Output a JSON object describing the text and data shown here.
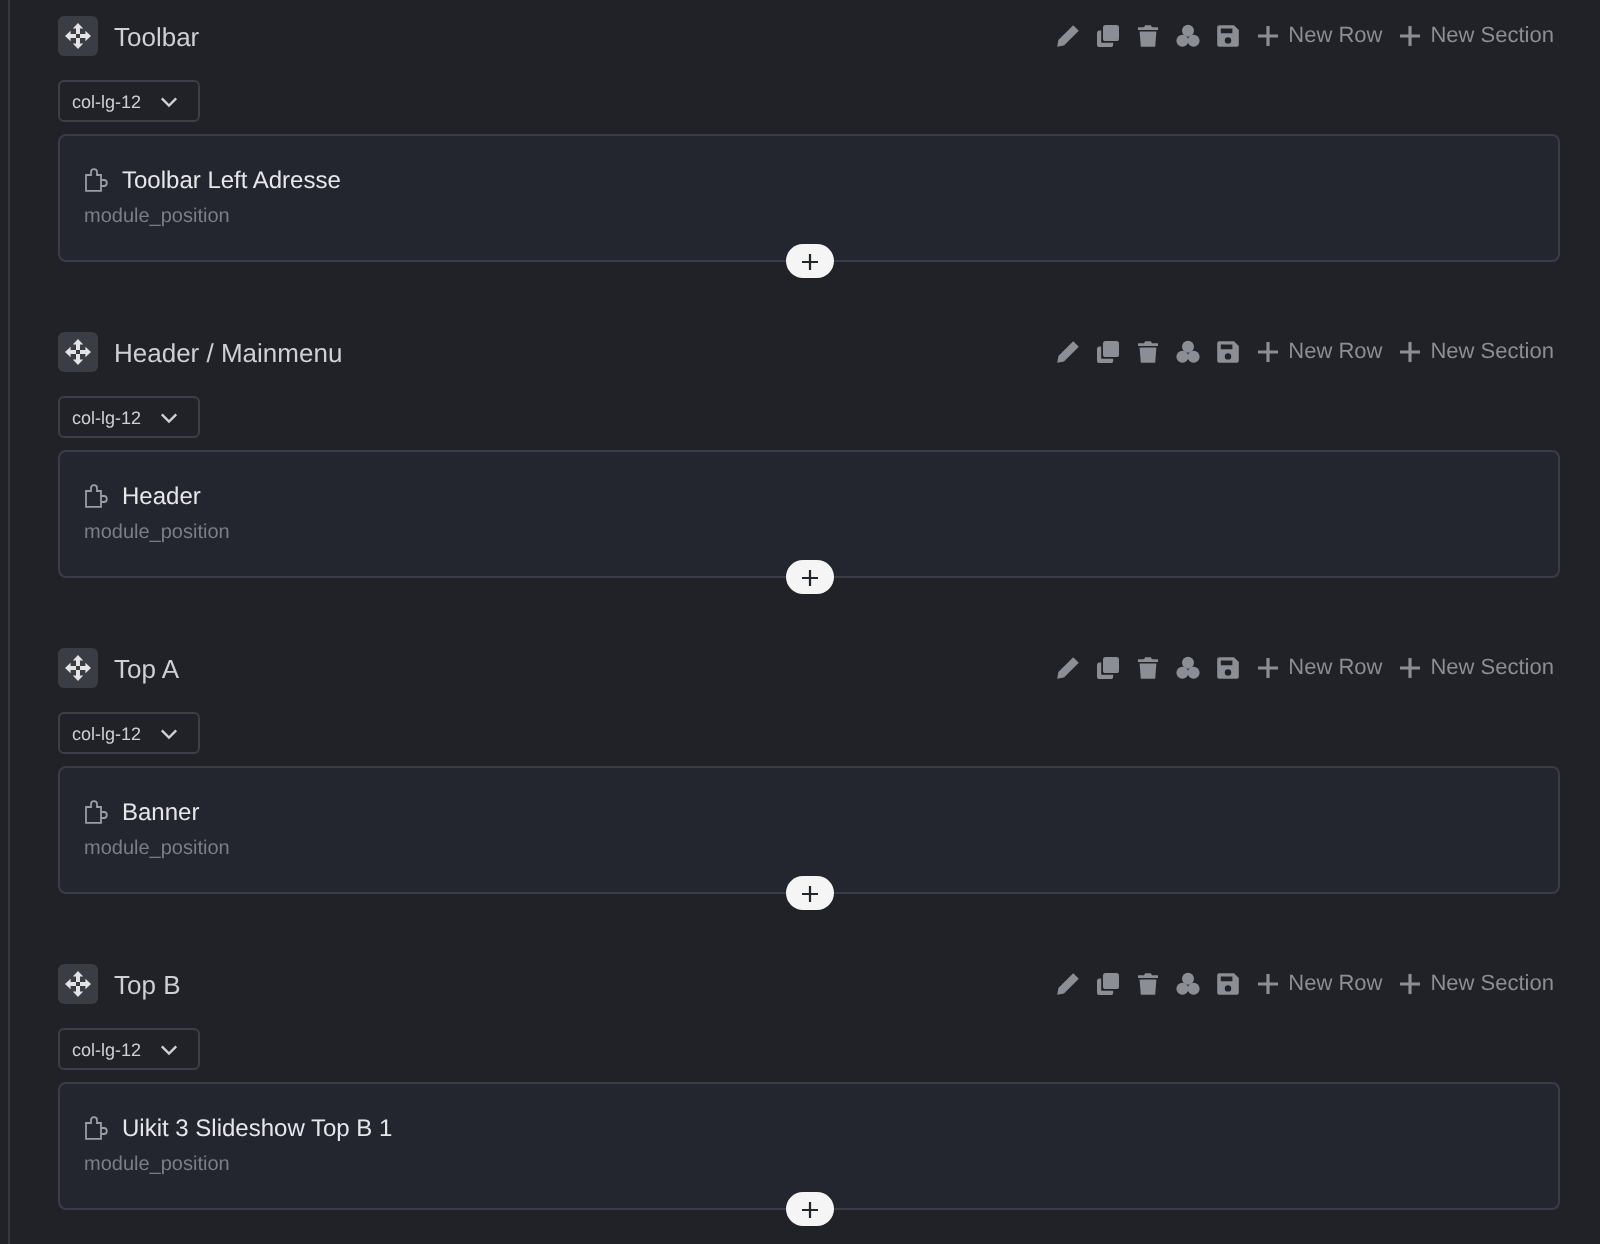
{
  "sections": [
    {
      "title": "Toolbar",
      "new_row": "New Row",
      "new_section": "New Section",
      "column": "col-lg-12",
      "modules": [
        {
          "title": "Toolbar Left Adresse",
          "position": "module_position"
        }
      ]
    },
    {
      "title": "Header / Mainmenu",
      "new_row": "New Row",
      "new_section": "New Section",
      "column": "col-lg-12",
      "modules": [
        {
          "title": "Header",
          "position": "module_position"
        }
      ]
    },
    {
      "title": "Top A",
      "new_row": "New Row",
      "new_section": "New Section",
      "column": "col-lg-12",
      "modules": [
        {
          "title": "Banner",
          "position": "module_position"
        }
      ]
    },
    {
      "title": "Top B",
      "new_row": "New Row",
      "new_section": "New Section",
      "column": "col-lg-12",
      "modules": [
        {
          "title": "Uikit 3 Slideshow Top B 1",
          "position": "module_position"
        }
      ]
    }
  ]
}
